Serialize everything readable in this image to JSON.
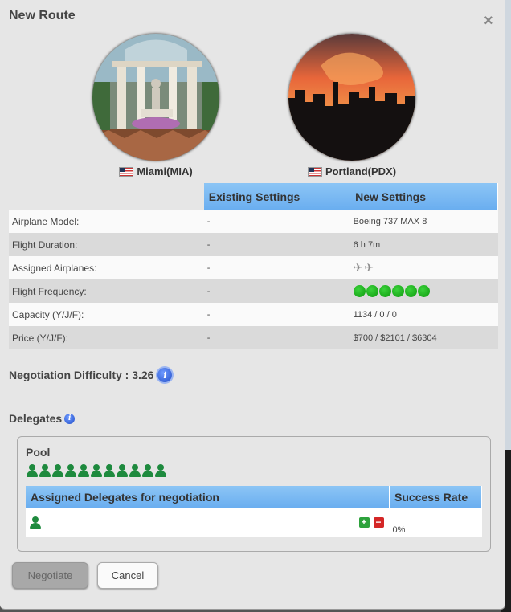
{
  "modal": {
    "title": "New Route",
    "close_icon": "×"
  },
  "origin": {
    "name": "Miami(MIA)",
    "flag": "us-flag-icon"
  },
  "destination": {
    "name": "Portland(PDX)",
    "flag": "us-flag-icon"
  },
  "settings": {
    "headers": {
      "existing": "Existing Settings",
      "new": "New Settings"
    },
    "rows": [
      {
        "label": "Airplane Model:",
        "existing": "-",
        "new": "Boeing 737 MAX 8"
      },
      {
        "label": "Flight Duration:",
        "existing": "-",
        "new": "6 h 7m"
      },
      {
        "label": "Assigned Airplanes:",
        "existing": "-",
        "new_airplane_count": 2
      },
      {
        "label": "Flight Frequency:",
        "existing": "-",
        "new_frequency": 6
      },
      {
        "label": "Capacity (Y/J/F):",
        "existing": "-",
        "new": "1134 / 0 / 0"
      },
      {
        "label": "Price (Y/J/F):",
        "existing": "-",
        "new": "$700 / $2101 / $6304"
      }
    ]
  },
  "negotiation": {
    "label": "Negotiation Difficulty : 3.26",
    "info_icon": "i"
  },
  "delegates": {
    "title": "Delegates",
    "info_icon": "i",
    "pool_title": "Pool",
    "pool_count": 11,
    "table_headers": {
      "assigned": "Assigned Delegates for negotiation",
      "success": "Success Rate"
    },
    "assigned_count": 1,
    "success_rate": "0%",
    "plus_label": "+",
    "minus_label": "−"
  },
  "buttons": {
    "negotiate": "Negotiate",
    "cancel": "Cancel"
  },
  "colors": {
    "header_blue": "#79b8f2",
    "frequency_green": "#1ab51a",
    "delegate_green": "#1e8a3e"
  }
}
